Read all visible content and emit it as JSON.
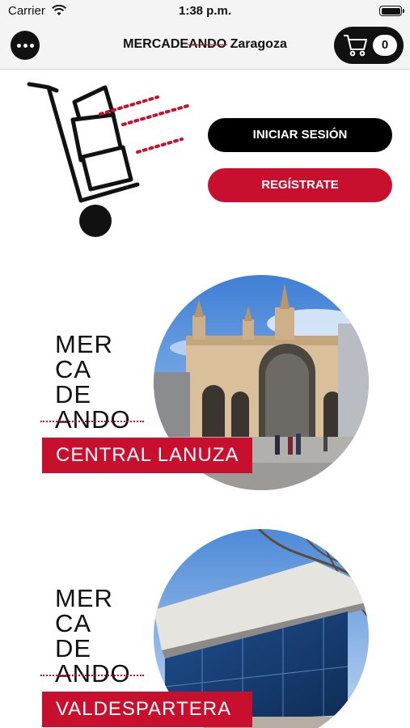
{
  "status": {
    "carrier": "Carrier",
    "time": "1:38 p.m."
  },
  "nav": {
    "title_part1": "MERCADE",
    "title_strike": "ANDO",
    "title_part2": " Zaragoza",
    "cart_count": "0"
  },
  "auth": {
    "login_label": "INICIAR SESIÓN",
    "register_label": "REGÍSTRATE"
  },
  "markets": [
    {
      "logo_lines": [
        "MER",
        "CA",
        "DE",
        "ANDO"
      ],
      "name": "CENTRAL LANUZA"
    },
    {
      "logo_lines": [
        "MER",
        "CA",
        "DE",
        "ANDO"
      ],
      "name": "VALDESPARTERA"
    }
  ],
  "icons": {
    "menu": "more-dots-icon",
    "cart": "shopping-cart-icon",
    "wifi": "wifi-icon",
    "battery": "battery-icon",
    "hero": "hand-truck-icon"
  },
  "colors": {
    "brand_red": "#c8102e",
    "black": "#000000",
    "nav_bg": "#f4f4f5"
  }
}
